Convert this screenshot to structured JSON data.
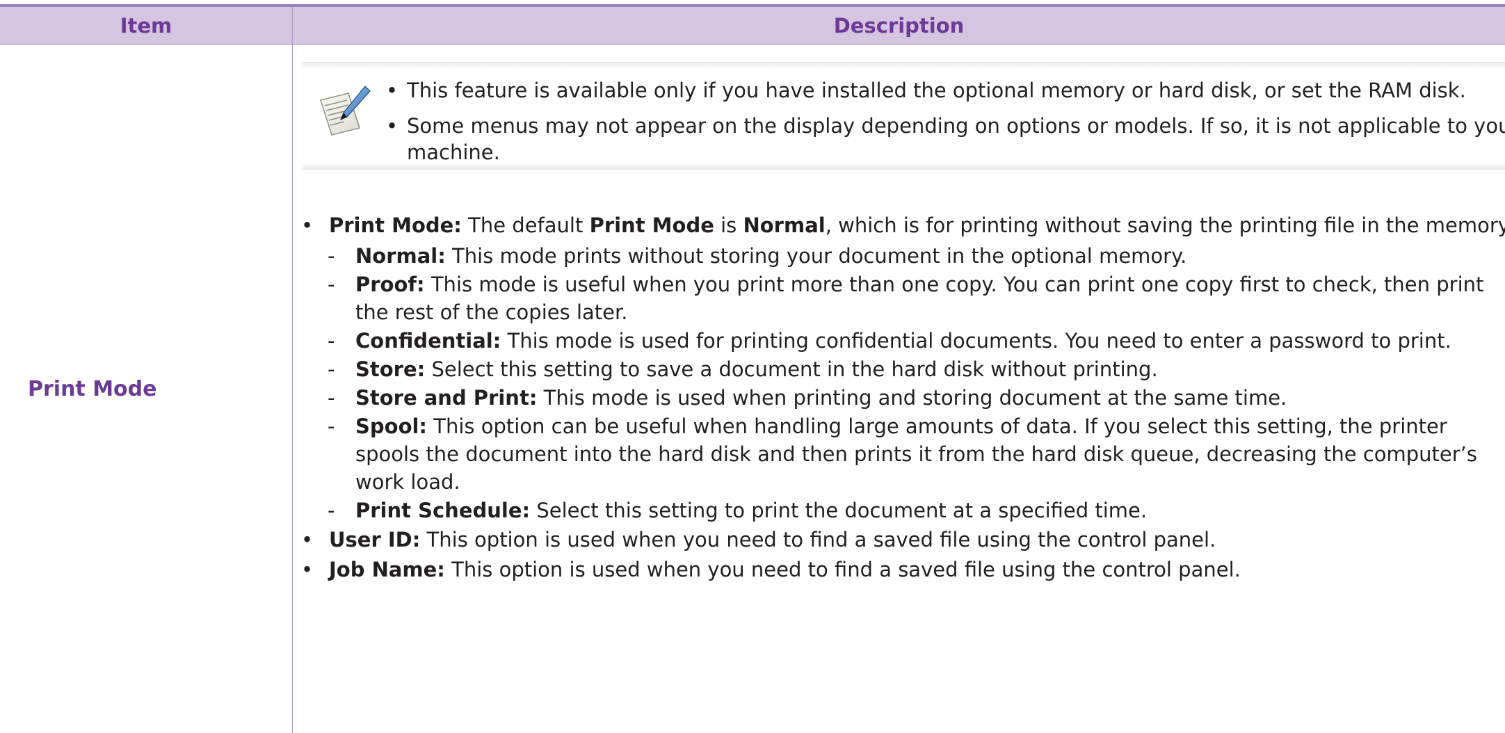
{
  "table": {
    "header": {
      "item": "Item",
      "description": "Description"
    },
    "row": {
      "item": "Print Mode",
      "note": {
        "icon": "note-pencil-icon",
        "bullets": [
          "This feature is available only if you have installed the optional memory or hard disk, or set the RAM disk.",
          "Some menus may not appear on the display depending on options or models. If so, it is not applicable to your machine."
        ]
      },
      "desc": {
        "print_mode": {
          "label": "Print Mode:",
          "text1": " The default ",
          "bold1": "Print Mode",
          "text2": " is ",
          "bold2": "Normal",
          "text3": ", which is for printing without saving the printing file in the memory."
        },
        "sub_items": [
          {
            "label": "Normal:",
            "text": " This mode prints without storing your document in the optional memory."
          },
          {
            "label": "Proof:",
            "text": " This mode is useful when you print more than one copy. You can print one copy first to check, then print the rest of the copies later."
          },
          {
            "label": "Confidential:",
            "text": " This mode is used for printing confidential documents. You need to enter a password to print."
          },
          {
            "label": "Store:",
            "text": " Select this setting to save a document in the hard disk without printing."
          },
          {
            "label": "Store and Print:",
            "text": " This mode is used when printing and storing document at the same time."
          },
          {
            "label": "Spool:",
            "text": " This option can be useful when handling large amounts of data. If you select this setting, the printer spools the document into the hard disk and then prints it from the hard disk queue, decreasing the computer’s work load."
          },
          {
            "label": "Print Schedule:",
            "text": " Select this setting to print the document at a specified time."
          }
        ],
        "user_id": {
          "label": "User ID:",
          "text": " This option is used when you need to find a saved file using the control panel."
        },
        "job_name": {
          "label": "Job Name:",
          "text": " This option is used when you need to find a saved file using the control panel."
        }
      }
    }
  },
  "colors": {
    "header_bg": "#d5c5e1",
    "accent_purple": "#6b3a96",
    "border": "#9b7fbf"
  }
}
